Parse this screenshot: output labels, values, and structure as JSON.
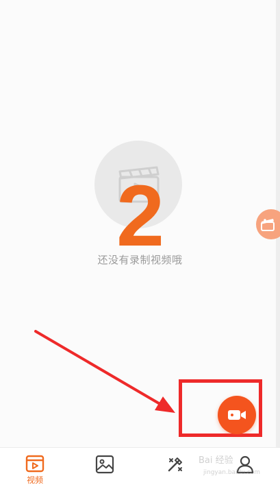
{
  "empty_state": {
    "message": "还没有录制视频哦",
    "icon": "film-clapper-play-icon"
  },
  "annotation": {
    "step_number": "2",
    "arrow_color": "#ee2a2a",
    "box_color": "#ee2a2a"
  },
  "floating_tab": {
    "icon": "clapperboard-icon"
  },
  "record_button": {
    "icon": "video-camera-icon",
    "color": "#f4541e"
  },
  "bottom_nav": {
    "items": [
      {
        "label": "视频",
        "icon": "video-tab-icon",
        "active": true
      },
      {
        "label": "",
        "icon": "image-tab-icon",
        "active": false
      },
      {
        "label": "",
        "icon": "tools-tab-icon",
        "active": false
      },
      {
        "label": "",
        "icon": "profile-tab-icon",
        "active": false
      }
    ]
  },
  "watermark": {
    "text": "Bai 经验",
    "sub": "jingyan.baidu.com"
  },
  "colors": {
    "accent": "#f06a1e",
    "inactive": "#444444"
  }
}
